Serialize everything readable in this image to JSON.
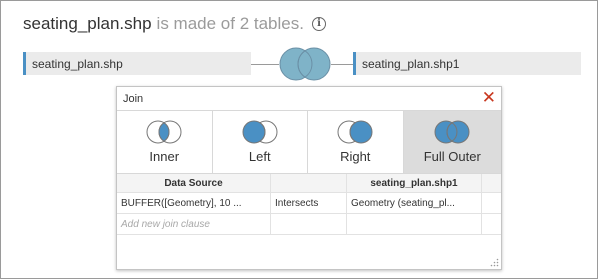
{
  "header": {
    "filename": "seating_plan.shp",
    "suffix": "is made of 2 tables.",
    "info_glyph": "i"
  },
  "tables": {
    "left": "seating_plan.shp",
    "right": "seating_plan.shp1"
  },
  "join_icon": {
    "type": "full-outer",
    "fill_color": "#7fb3c8",
    "stroke_color": "#6a8fa5"
  },
  "dialog": {
    "title": "Join",
    "close_glyph": "✕",
    "join_types": [
      {
        "label": "Inner",
        "selected": false,
        "icon": "inner-join-icon"
      },
      {
        "label": "Left",
        "selected": false,
        "icon": "left-join-icon"
      },
      {
        "label": "Right",
        "selected": false,
        "icon": "right-join-icon"
      },
      {
        "label": "Full Outer",
        "selected": true,
        "icon": "full-outer-join-icon"
      }
    ],
    "grid": {
      "headers": [
        "Data Source",
        "",
        "seating_plan.shp1",
        ""
      ],
      "rows": [
        {
          "left": "BUFFER([Geometry], 10 ...",
          "operator": "Intersects",
          "right": "Geometry (seating_pl..."
        }
      ],
      "add_clause_placeholder": "Add new join clause"
    }
  },
  "colors": {
    "accent": "#4a90c4",
    "venn_fill": "#4a90c4",
    "close": "#c8371f"
  }
}
